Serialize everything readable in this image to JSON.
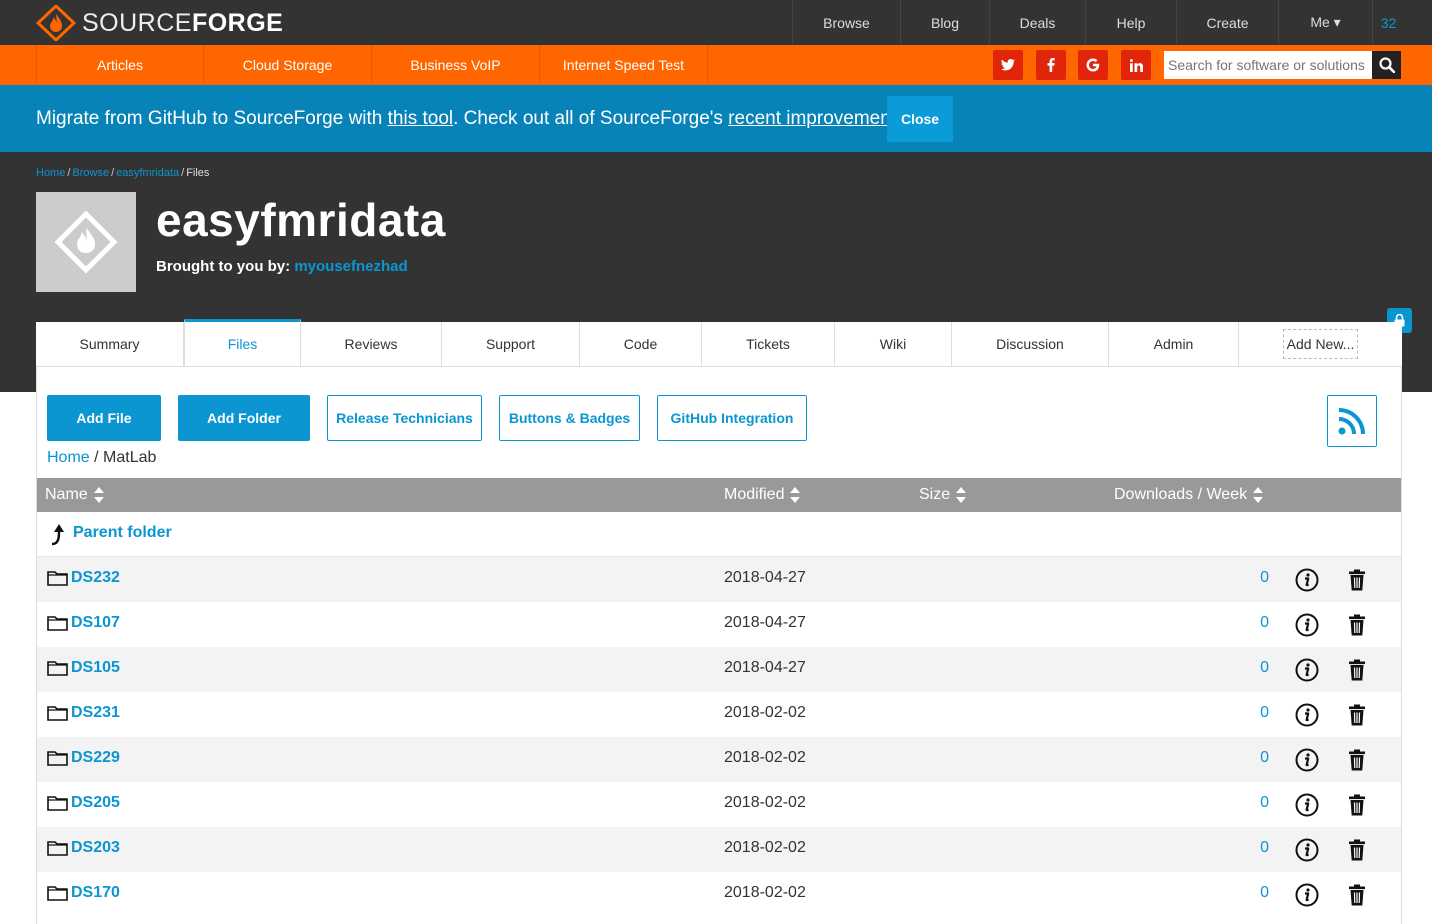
{
  "header": {
    "logo": {
      "text_light": "SOURCE",
      "text_bold": "FORGE"
    },
    "nav": [
      "Browse",
      "Blog",
      "Deals",
      "Help",
      "Create",
      "Me ▾",
      "32"
    ]
  },
  "subbar": {
    "links": [
      "Articles",
      "Cloud Storage",
      "Business VoIP",
      "Internet Speed Test"
    ],
    "social": [
      "twitter-icon",
      "facebook-icon",
      "google-icon",
      "linkedin-icon"
    ],
    "search_placeholder": "Search for software or solutions"
  },
  "notice": {
    "text1": "Migrate from GitHub to SourceForge with ",
    "link1": "this tool",
    "text2": ". Check out all of SourceForge's ",
    "link2": "recent improvements.",
    "close_label": "Close"
  },
  "breadcrumb": {
    "home": "Home",
    "browse": "Browse",
    "project": "easyfmridata",
    "current": "Files"
  },
  "project": {
    "title": "easyfmridata",
    "brought_by_label": "Brought to you by:",
    "author": "myousefnezhad"
  },
  "tabs": [
    "Summary",
    "Files",
    "Reviews",
    "Support",
    "Code",
    "Tickets",
    "Wiki",
    "Discussion",
    "Admin",
    "Add New..."
  ],
  "active_tab": "Files",
  "actions": {
    "add_file": "Add File",
    "add_folder": "Add Folder",
    "release_technicians": "Release Technicians",
    "buttons_badges": "Buttons & Badges",
    "github_integration": "GitHub Integration"
  },
  "path": {
    "home": "Home",
    "sep": " / ",
    "current": "MatLab"
  },
  "table": {
    "columns": [
      "Name",
      "Modified",
      "Size",
      "Downloads / Week"
    ],
    "parent_label": "Parent folder",
    "rows": [
      {
        "name": "DS232",
        "modified": "2018-04-27",
        "downloads": "0"
      },
      {
        "name": "DS107",
        "modified": "2018-04-27",
        "downloads": "0"
      },
      {
        "name": "DS105",
        "modified": "2018-04-27",
        "downloads": "0"
      },
      {
        "name": "DS231",
        "modified": "2018-02-02",
        "downloads": "0"
      },
      {
        "name": "DS229",
        "modified": "2018-02-02",
        "downloads": "0"
      },
      {
        "name": "DS205",
        "modified": "2018-02-02",
        "downloads": "0"
      },
      {
        "name": "DS203",
        "modified": "2018-02-02",
        "downloads": "0"
      },
      {
        "name": "DS170",
        "modified": "2018-02-02",
        "downloads": "0"
      }
    ]
  },
  "colors": {
    "dark": "#333333",
    "orange": "#ff6600",
    "blue": "#0b96d1",
    "notice_blue": "#0883b8",
    "table_header": "#999999"
  }
}
